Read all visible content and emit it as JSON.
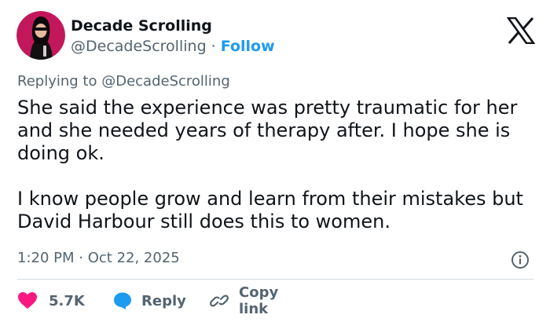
{
  "tweet": {
    "author": {
      "display_name": "Decade Scrolling",
      "handle": "@DecadeScrolling",
      "separator": "·",
      "follow_label": "Follow"
    },
    "replying_prefix": "Replying to",
    "replying_handle": "@DecadeScrolling",
    "paragraphs": [
      "She said the experience was pretty traumatic for her and she needed years of therapy after. I hope she is doing ok.",
      "I know people grow and learn from their mistakes but David Harbour still does this to women."
    ],
    "time": "1:20 PM",
    "meta_separator": "·",
    "date": "Oct 22, 2025"
  },
  "actions": {
    "like_count": "5.7K",
    "reply_label": "Reply",
    "copy_link_label": "Copy link"
  },
  "colors": {
    "text": "#0f1419",
    "secondary": "#536471",
    "accent": "#1d9bf0",
    "like": "#f91880",
    "divider": "#cfd9de"
  },
  "icons": [
    "x-logo-icon",
    "info-icon",
    "heart-icon",
    "speech-bubble-icon",
    "link-icon"
  ]
}
